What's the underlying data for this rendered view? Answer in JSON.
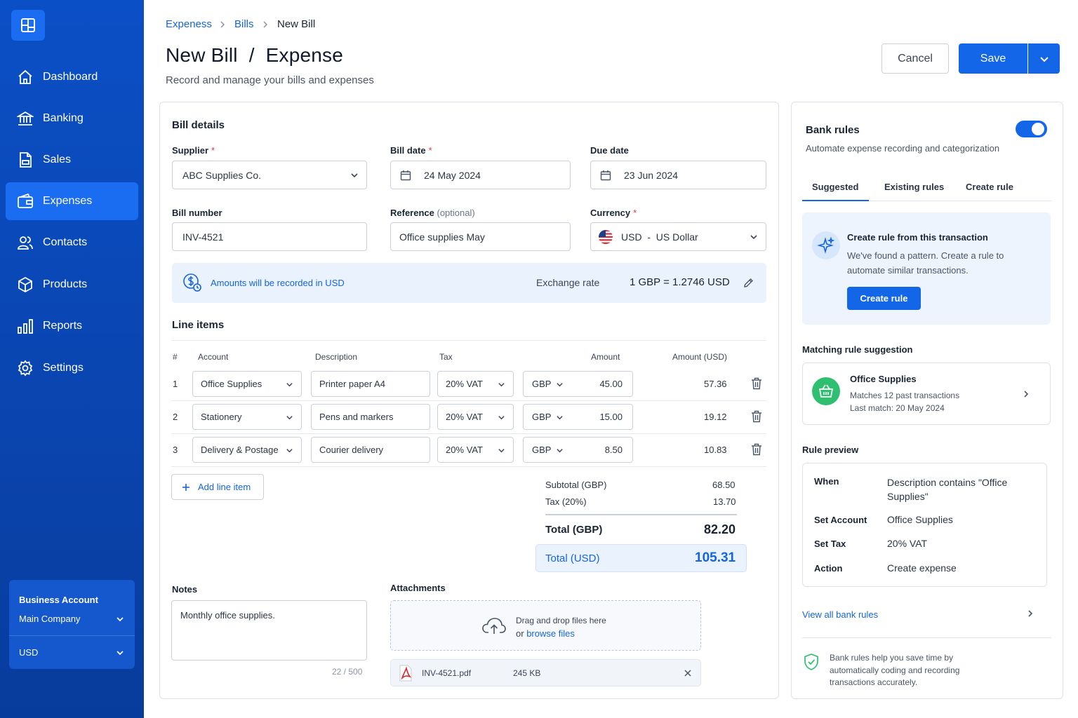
{
  "sidebar": {
    "logo_icon": "grid-logo-icon",
    "items": [
      {
        "label": "Dashboard",
        "icon": "home-icon"
      },
      {
        "label": "Banking",
        "icon": "bank-icon"
      },
      {
        "label": "Sales",
        "icon": "invoice-icon"
      },
      {
        "label": "Expenses",
        "icon": "wallet-icon",
        "active": true
      },
      {
        "label": "Contacts",
        "icon": "users-icon"
      },
      {
        "label": "Products",
        "icon": "box-icon"
      },
      {
        "label": "Reports",
        "icon": "bar-chart-icon"
      },
      {
        "label": "Settings",
        "icon": "gear-icon"
      }
    ],
    "account": {
      "title": "Business Account",
      "company": "Main Company",
      "currency": "USD"
    }
  },
  "breadcrumb": [
    "Expeness",
    "Bills",
    "New Bill"
  ],
  "header": {
    "title": "New Bill  /  Expense",
    "subtitle": "Record and manage your bills and expenses",
    "cancel_label": "Cancel",
    "save_label": "Save"
  },
  "bill": {
    "section_title": "Bill details",
    "supplier_label": "Supplier",
    "supplier_value": "ABC Supplies Co.",
    "bill_date_label": "Bill date",
    "bill_date_value": "24 May 2024",
    "due_date_label": "Due date",
    "due_date_value": "23 Jun 2024",
    "bill_number_label": "Bill number",
    "bill_number_value": "INV-4521",
    "reference_label": "Reference",
    "reference_optional": "(optional)",
    "reference_value": "Office supplies May",
    "currency_label": "Currency",
    "currency_value": "USD  -  US Dollar",
    "required_mark": "*",
    "banner_text": "Amounts will be recorded in USD",
    "exchange_label": "Exchange rate",
    "exchange_value": "1 GBP = 1.2746 USD"
  },
  "line_items": {
    "title": "Line items",
    "headers": [
      "#",
      "Account",
      "Description",
      "Tax",
      "Amount",
      "Amount (USD)"
    ],
    "rows": [
      {
        "n": "1",
        "account": "Office Supplies",
        "description": "Printer paper A4",
        "tax": "20% VAT",
        "currency": "GBP",
        "amount": "45.00",
        "usd": "57.36"
      },
      {
        "n": "2",
        "account": "Stationery",
        "description": "Pens and markers",
        "tax": "20% VAT",
        "currency": "GBP",
        "amount": "15.00",
        "usd": "19.12"
      },
      {
        "n": "3",
        "account": "Delivery & Postage",
        "description": "Courier delivery",
        "tax": "20% VAT",
        "currency": "GBP",
        "amount": "8.50",
        "usd": "10.83"
      }
    ],
    "add_label": "Add line item"
  },
  "totals": {
    "subtotal_label": "Subtotal (GBP)",
    "subtotal": "68.50",
    "tax_label": "Tax (20%)",
    "tax": "13.70",
    "total_gbp_label": "Total (GBP)",
    "total_gbp": "82.20",
    "total_usd_label": "Total (USD)",
    "total_usd": "105.31"
  },
  "notes": {
    "label": "Notes",
    "value": "Monthly office supplies.",
    "count": "22 / 500"
  },
  "attachments": {
    "label": "Attachments",
    "drop_text": "Drag and drop files here",
    "or_text": "or",
    "browse_text": "browse files",
    "file_name": "INV-4521.pdf",
    "file_size": "245 KB"
  },
  "rules": {
    "title": "Bank rules",
    "subtitle": "Automate expense recording and categorization",
    "tabs": [
      "Suggested",
      "Existing rules",
      "Create rule"
    ],
    "suggest_title": "Create rule from this transaction",
    "suggest_text_1": "We've found a pattern. Create a rule to",
    "suggest_text_2": "automate similar transactions.",
    "create_button": "Create rule",
    "matching_title": "Matching rule suggestion",
    "match_name": "Office Supplies",
    "match_line1": "Matches 12 past transactions",
    "match_line2": "Last match: 20 May 2024",
    "preview_title": "Rule preview",
    "preview": [
      {
        "key": "When",
        "value": "Description contains \"Office Supplies\""
      },
      {
        "key": "Set Account",
        "value": "Office Supplies"
      },
      {
        "key": "Set Tax",
        "value": "20% VAT"
      },
      {
        "key": "Action",
        "value": "Create expense"
      }
    ],
    "view_all": "View all bank rules",
    "footer_1": "Bank rules help you save time by",
    "footer_2": "automatically coding and recording",
    "footer_3": "transactions accurately."
  },
  "colors": {
    "brand": "#1466e8",
    "sidebar": "#0b4fc6",
    "required": "#e0344a",
    "success": "#2fbf71"
  }
}
